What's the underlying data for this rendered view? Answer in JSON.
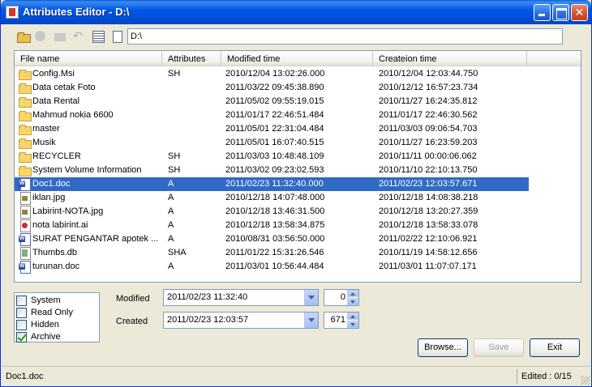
{
  "window": {
    "title": "Attributes Editor - D:\\"
  },
  "toolbar": {
    "path_value": "D:\\"
  },
  "list": {
    "columns": [
      "File name",
      "Attributes",
      "Modified time",
      "Createion time"
    ],
    "rows": [
      {
        "icon": "folder",
        "name": "Config.Msi",
        "attr": "SH",
        "modified": "2010/12/04 13:02:26.000",
        "created": "2010/12/04 12:03:44.750"
      },
      {
        "icon": "folder",
        "name": "Data cetak Foto",
        "attr": "",
        "modified": "2011/03/22 09:45:38.890",
        "created": "2010/12/12 16:57:23.734"
      },
      {
        "icon": "folder",
        "name": "Data Rental",
        "attr": "",
        "modified": "2011/05/02 09:55:19.015",
        "created": "2010/11/27 16:24:35.812"
      },
      {
        "icon": "folder",
        "name": "Mahmud nokia 6600",
        "attr": "",
        "modified": "2011/01/17 22:46:51.484",
        "created": "2011/01/17 22:46:30.562"
      },
      {
        "icon": "folder",
        "name": "master",
        "attr": "",
        "modified": "2011/05/01 22:31:04.484",
        "created": "2011/03/03 09:06:54.703"
      },
      {
        "icon": "folder",
        "name": "Musik",
        "attr": "",
        "modified": "2011/05/01 16:07:40.515",
        "created": "2010/11/27 16:23:59.203"
      },
      {
        "icon": "folder",
        "name": "RECYCLER",
        "attr": "SH",
        "modified": "2011/03/03 10:48:48.109",
        "created": "2010/11/11 00:00:06.062"
      },
      {
        "icon": "folder",
        "name": "System Volume Information",
        "attr": "SH",
        "modified": "2011/03/02 09:23:02.593",
        "created": "2010/11/10 22:10:13.750"
      },
      {
        "icon": "doc",
        "name": "Doc1.doc",
        "attr": "A",
        "modified": "2011/02/23 11:32:40.000",
        "created": "2011/02/23 12:03:57.671",
        "selected": true
      },
      {
        "icon": "img",
        "name": "iklan.jpg",
        "attr": "A",
        "modified": "2010/12/18 14:07:48.000",
        "created": "2010/12/18 14:08:38.218"
      },
      {
        "icon": "img",
        "name": "Labirint-NOTA.jpg",
        "attr": "A",
        "modified": "2010/12/18 13:46:31.500",
        "created": "2010/12/18 13:20:27.359"
      },
      {
        "icon": "ai",
        "name": "nota labirint.ai",
        "attr": "A",
        "modified": "2010/12/18 13:58:34.875",
        "created": "2010/12/18 13:58:33.078"
      },
      {
        "icon": "doc",
        "name": "SURAT PENGANTAR apotek ...",
        "attr": "A",
        "modified": "2010/08/31 03:56:50.000",
        "created": "2011/02/22 12:10:06.921"
      },
      {
        "icon": "db",
        "name": "Thumbs.db",
        "attr": "SHA",
        "modified": "2011/01/22 15:31:26.546",
        "created": "2010/11/19 14:58:12.656"
      },
      {
        "icon": "doc",
        "name": "turunan.doc",
        "attr": "A",
        "modified": "2011/03/01 10:56:44.484",
        "created": "2011/03/01 11:07:07.171"
      }
    ]
  },
  "attributes": [
    {
      "label": "System",
      "checked": false
    },
    {
      "label": "Read Only",
      "checked": false
    },
    {
      "label": "Hidden",
      "checked": false
    },
    {
      "label": "Archive",
      "checked": true
    }
  ],
  "times": {
    "modified_label": "Modified",
    "modified_value": "2011/02/23 11:32:40",
    "modified_ms": "0",
    "created_label": "Created",
    "created_value": "2011/02/23 12:03:57",
    "created_ms": "671"
  },
  "buttons": {
    "browse": "Browse...",
    "save": "Save",
    "exit": "Exit"
  },
  "status": {
    "left": "Doc1.doc",
    "right": "Edited :   0/15"
  },
  "colors": {
    "selection": "#316AC5",
    "titlebar": "#0058E6"
  }
}
